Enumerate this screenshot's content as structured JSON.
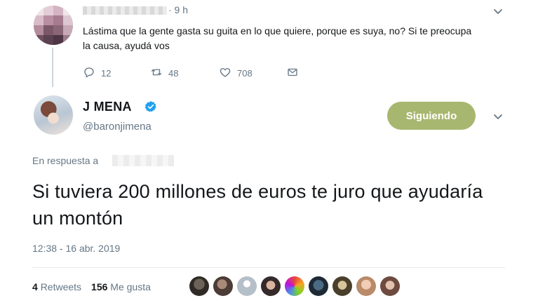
{
  "parent_tweet": {
    "time": "· 9 h",
    "text": "Lástima que la gente gasta su guita en lo que quiere, porque es suya, no? Si te preocupa la causa, ayudá vos",
    "actions": {
      "replies": "12",
      "retweets": "48",
      "likes": "708"
    }
  },
  "main_tweet": {
    "display_name": "J MENA",
    "handle": "@baronjimena",
    "follow_label": "Siguiendo",
    "reply_prefix": "En respuesta a",
    "text": "Si tuviera 200 millones de euros te juro que ayudaría un montón",
    "timestamp": "12:38 - 16 abr. 2019",
    "retweet_count": "4",
    "retweet_label": "Retweets",
    "like_count": "156",
    "like_label": "Me gusta"
  },
  "colors": {
    "follow_button": "#a8b770",
    "verified": "#1da1f2",
    "muted_text": "#657786"
  },
  "icons": [
    "reply-icon",
    "retweet-icon",
    "like-icon",
    "dm-icon",
    "chevron-down-icon",
    "verified-badge-icon"
  ]
}
